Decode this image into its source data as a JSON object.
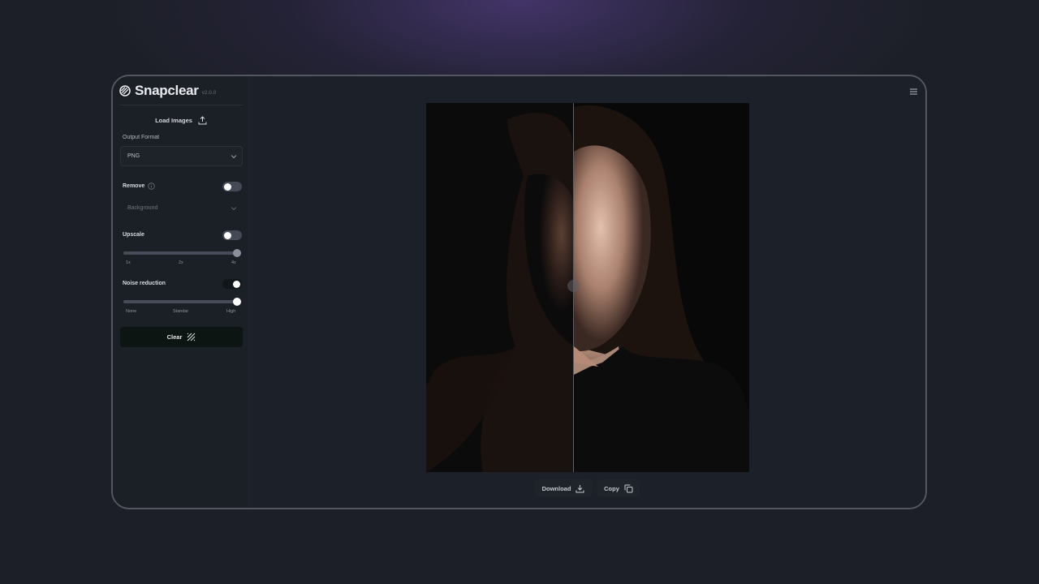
{
  "app": {
    "name": "Snapclear",
    "version": "v2.0.0"
  },
  "sidebar": {
    "load_images_label": "Load Images",
    "output_format": {
      "label": "Output Format",
      "selected": "PNG"
    },
    "remove": {
      "label": "Remove",
      "enabled": false,
      "select_placeholder": "Background"
    },
    "upscale": {
      "label": "Upscale",
      "enabled": false,
      "ticks": [
        "1x",
        "2x",
        "4x"
      ],
      "value": "4x"
    },
    "noise_reduction": {
      "label": "Noise reduction",
      "enabled": true,
      "ticks": [
        "None",
        "Standar",
        "High"
      ],
      "value": "High"
    },
    "clear_label": "Clear"
  },
  "preview": {
    "split_fraction": 0.46
  },
  "actions": {
    "download_label": "Download",
    "copy_label": "Copy"
  },
  "colors": {
    "accent_dark": "#0c1512",
    "slider_track": "#474c58",
    "toggle_off": "#444955",
    "toggle_on": "#10161a"
  },
  "icons": {
    "logo": "snapclear-logo-icon",
    "upload": "upload-icon",
    "chevron": "chevron-down-icon",
    "info": "info-icon",
    "clear": "diagonal-lines-icon",
    "menu": "hamburger-menu-icon",
    "download": "download-icon",
    "copy": "copy-icon"
  }
}
